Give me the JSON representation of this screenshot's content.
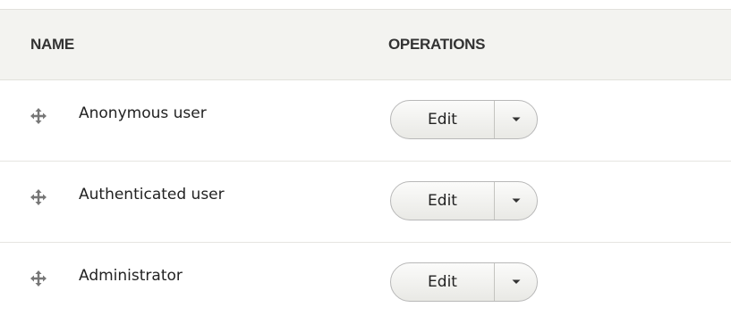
{
  "table": {
    "headers": {
      "name": "NAME",
      "operations": "OPERATIONS"
    },
    "rows": [
      {
        "label": "Anonymous user",
        "operation": "Edit"
      },
      {
        "label": "Authenticated user",
        "operation": "Edit"
      },
      {
        "label": "Administrator",
        "operation": "Edit"
      }
    ]
  },
  "icons": {
    "drag_handle": "drag-handle-icon",
    "dropdown": "chevron-down-icon"
  },
  "colors": {
    "header_bg": "#f3f3f0",
    "border": "#e2e1dc",
    "text": "#222222",
    "button_border": "#b8b8b8"
  }
}
